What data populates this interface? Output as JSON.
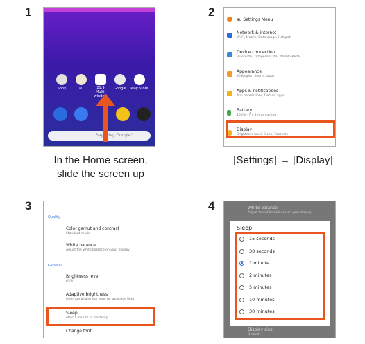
{
  "steps": {
    "s1": {
      "number": "1",
      "caption_line1": "In the Home screen,",
      "caption_line2": "slide the screen up"
    },
    "s2": {
      "number": "2",
      "caption": "[Settings] → [Display]"
    },
    "s3": {
      "number": "3"
    },
    "s4": {
      "number": "4"
    }
  },
  "home": {
    "apps": [
      "Sony",
      "au",
      "Multi-window",
      "Google",
      "Play Store"
    ],
    "multi_window_top": "21:9",
    "search_hint": "Say \"Hey Google\""
  },
  "settings": {
    "items": [
      {
        "title": "au Settings Menu",
        "sub": ""
      },
      {
        "title": "Network & internet",
        "sub": "Wi-Fi, Mobile, Data usage, Hotspot"
      },
      {
        "title": "Device connection",
        "sub": "Bluetooth, TV/Speaker, NFC/Osaifu-Keitai"
      },
      {
        "title": "Appearance",
        "sub": "Wallpaper, Xperia Loops"
      },
      {
        "title": "Apps & notifications",
        "sub": "App permissions, Default apps"
      },
      {
        "title": "Battery",
        "sub": "100% - 7 d 1 h remaining"
      },
      {
        "title": "Display",
        "sub": "Brightness level, Sleep, Font size"
      }
    ]
  },
  "display": {
    "section_quality": "Quality",
    "color_title": "Color gamut and contrast",
    "color_sub": "Standard mode",
    "wb_title": "White balance",
    "wb_sub": "Adjust the white balance on your display",
    "section_general": "General",
    "bright_title": "Brightness level",
    "bright_sub": "65%",
    "adaptive_title": "Adaptive brightness",
    "adaptive_sub": "Optimize brightness level for available light",
    "sleep_title": "Sleep",
    "sleep_sub": "After 1 minute of inactivity",
    "font_title": "Change font"
  },
  "sleep_dialog": {
    "bg_title": "White balance",
    "bg_sub": "Adjust the white balance on your display",
    "title": "Sleep",
    "options": [
      "15 seconds",
      "30 seconds",
      "1 minute",
      "2 minutes",
      "5 minutes",
      "10 minutes",
      "30 minutes"
    ],
    "selected": "1 minute",
    "bottom_title": "Display size",
    "bottom_sub": "Default"
  },
  "colors": {
    "accent": "#e8551f",
    "link": "#3a6fd8"
  }
}
